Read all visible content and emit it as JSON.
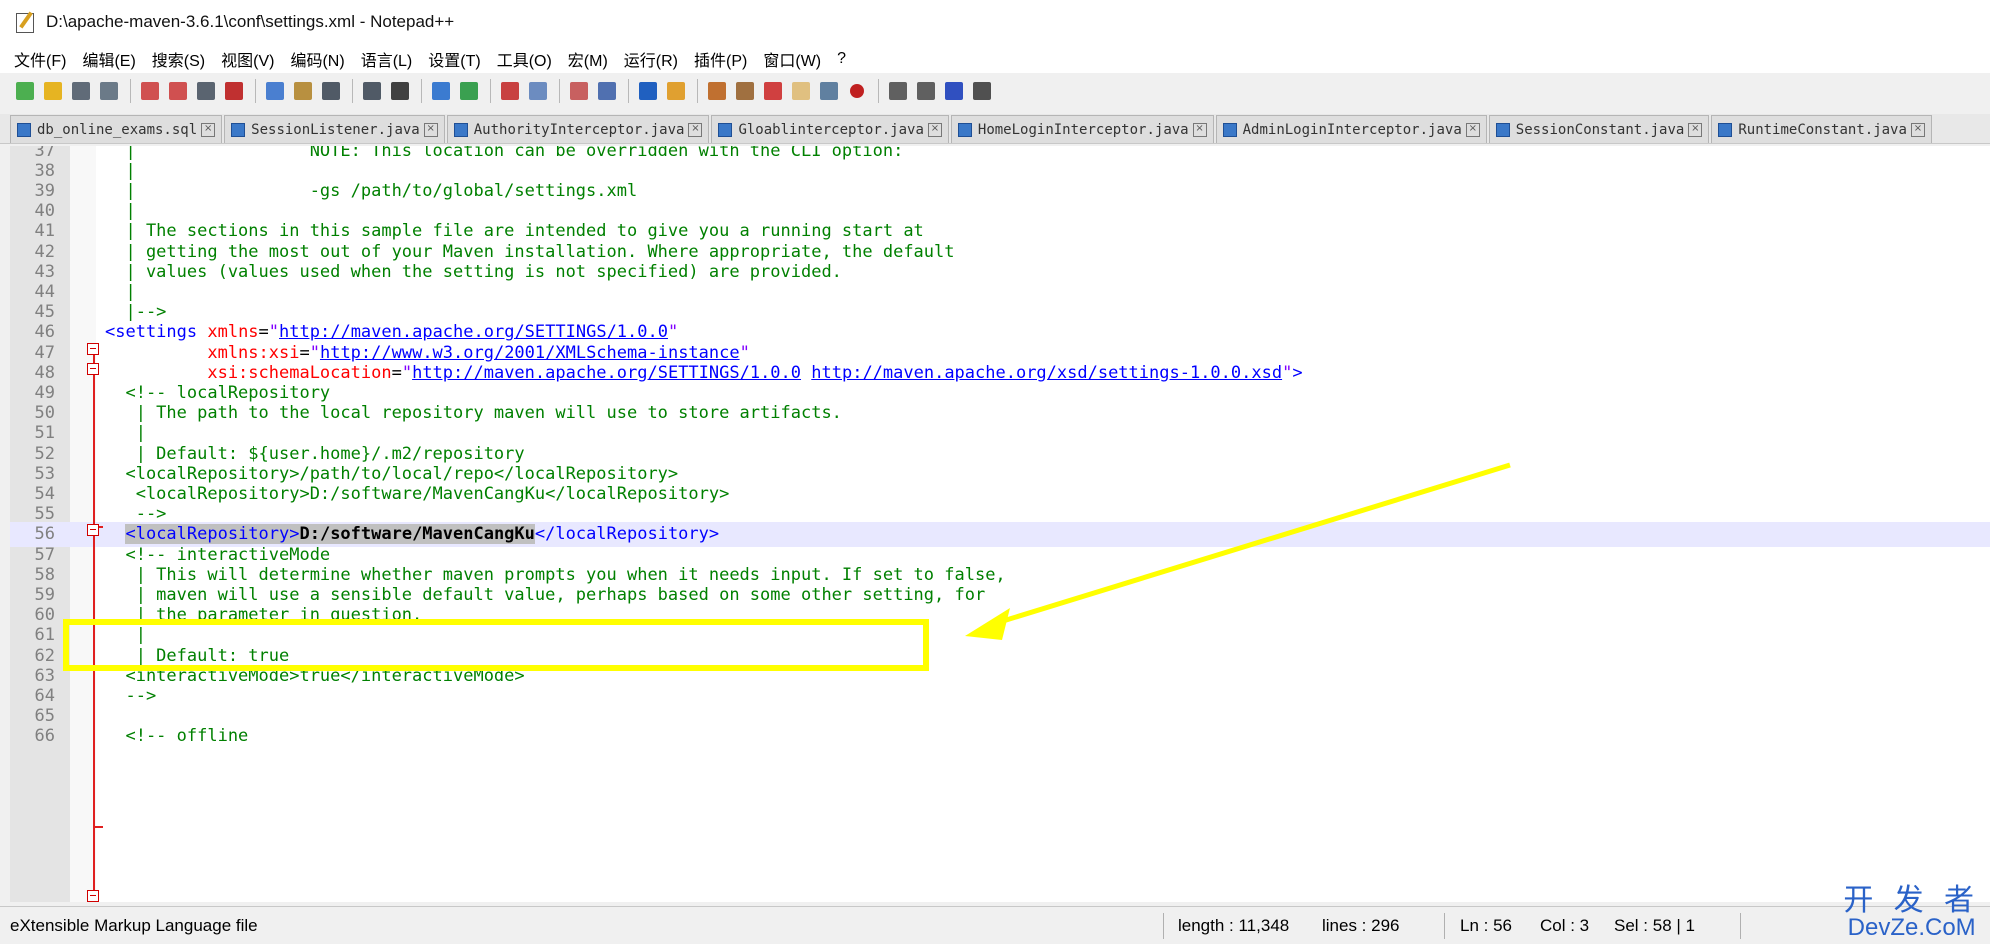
{
  "window": {
    "title": "D:\\apache-maven-3.6.1\\conf\\settings.xml - Notepad++"
  },
  "menu": [
    "文件(F)",
    "编辑(E)",
    "搜索(S)",
    "视图(V)",
    "编码(N)",
    "语言(L)",
    "设置(T)",
    "工具(O)",
    "宏(M)",
    "运行(R)",
    "插件(P)",
    "窗口(W)",
    "?"
  ],
  "tabs": [
    {
      "label": "db_online_exams.sql"
    },
    {
      "label": "SessionListener.java"
    },
    {
      "label": "AuthorityInterceptor.java"
    },
    {
      "label": "Gloablinterceptor.java"
    },
    {
      "label": "HomeLoginInterceptor.java"
    },
    {
      "label": "AdminLoginInterceptor.java"
    },
    {
      "label": "SessionConstant.java"
    },
    {
      "label": "RuntimeConstant.java"
    }
  ],
  "editor": {
    "lines": [
      {
        "n": "37",
        "segs": [
          {
            "t": "  |                 NOTE: This location can be overridden with the CLI option:",
            "c": "c"
          }
        ]
      },
      {
        "n": "38",
        "segs": [
          {
            "t": "  |",
            "c": "c"
          }
        ]
      },
      {
        "n": "39",
        "segs": [
          {
            "t": "  |                 -gs /path/to/global/settings.xml",
            "c": "c"
          }
        ]
      },
      {
        "n": "40",
        "segs": [
          {
            "t": "  |",
            "c": "c"
          }
        ]
      },
      {
        "n": "41",
        "segs": [
          {
            "t": "  | The sections in this sample file are intended to give you a running start at",
            "c": "c"
          }
        ]
      },
      {
        "n": "42",
        "segs": [
          {
            "t": "  | getting the most out of your Maven installation. Where appropriate, the default",
            "c": "c"
          }
        ]
      },
      {
        "n": "43",
        "segs": [
          {
            "t": "  | values (values used when the setting is not specified) are provided.",
            "c": "c"
          }
        ]
      },
      {
        "n": "44",
        "segs": [
          {
            "t": "  |",
            "c": "c"
          }
        ]
      },
      {
        "n": "45",
        "segs": [
          {
            "t": "  |-->",
            "c": "c"
          }
        ]
      },
      {
        "n": "46",
        "segs": [
          {
            "t": "<settings ",
            "c": "tag"
          },
          {
            "t": "xmlns",
            "c": "attr"
          },
          {
            "t": "=",
            "c": "eq"
          },
          {
            "t": "\"",
            "c": "val"
          },
          {
            "t": "http://maven.apache.org/SETTINGS/1.0.0",
            "c": "url"
          },
          {
            "t": "\"",
            "c": "val"
          }
        ]
      },
      {
        "n": "47",
        "segs": [
          {
            "t": "          xmlns:xsi",
            "c": "attr"
          },
          {
            "t": "=",
            "c": "eq"
          },
          {
            "t": "\"",
            "c": "val"
          },
          {
            "t": "http://www.w3.org/2001/XMLSchema-instance",
            "c": "url"
          },
          {
            "t": "\"",
            "c": "val"
          }
        ]
      },
      {
        "n": "48",
        "segs": [
          {
            "t": "          xsi:schemaLocation",
            "c": "attr"
          },
          {
            "t": "=",
            "c": "eq"
          },
          {
            "t": "\"",
            "c": "val"
          },
          {
            "t": "http://maven.apache.org/SETTINGS/1.0.0",
            "c": "url"
          },
          {
            "t": " ",
            "c": "val"
          },
          {
            "t": "http://maven.apache.org/xsd/settings-1.0.0.xsd",
            "c": "url"
          },
          {
            "t": "\"",
            "c": "val"
          },
          {
            "t": ">",
            "c": "tag"
          }
        ]
      },
      {
        "n": "49",
        "segs": [
          {
            "t": "  <!-- localRepository",
            "c": "c"
          }
        ]
      },
      {
        "n": "50",
        "segs": [
          {
            "t": "   | The path to the local repository maven will use to store artifacts.",
            "c": "c"
          }
        ]
      },
      {
        "n": "51",
        "segs": [
          {
            "t": "   |",
            "c": "c"
          }
        ]
      },
      {
        "n": "52",
        "segs": [
          {
            "t": "   | Default: ${user.home}/.m2/repository",
            "c": "c"
          }
        ]
      },
      {
        "n": "53",
        "segs": [
          {
            "t": "  <localRepository>/path/to/local/repo</localRepository>",
            "c": "c"
          }
        ]
      },
      {
        "n": "54",
        "segs": [
          {
            "t": "   <localRepository>D:/software/MavenCangKu</localRepository>",
            "c": "c"
          }
        ]
      },
      {
        "n": "55",
        "segs": [
          {
            "t": "   -->",
            "c": "c"
          }
        ]
      },
      {
        "n": "56",
        "cur": true,
        "segs": [
          {
            "t": "  ",
            "c": "black"
          },
          {
            "t": "<localRepository>",
            "c": "tagsel"
          },
          {
            "t": "D:/software/MavenCangKu",
            "c": "boldsel"
          },
          {
            "t": "</localRepository>",
            "c": "tag"
          }
        ]
      },
      {
        "n": "57",
        "segs": [
          {
            "t": "  <!-- interactiveMode",
            "c": "c"
          }
        ]
      },
      {
        "n": "58",
        "segs": [
          {
            "t": "   | This will determine whether maven prompts you when it needs input. If set to false,",
            "c": "c"
          }
        ]
      },
      {
        "n": "59",
        "segs": [
          {
            "t": "   | maven will use a sensible default value, perhaps based on some other setting, for",
            "c": "c"
          }
        ]
      },
      {
        "n": "60",
        "segs": [
          {
            "t": "   | the parameter in question.",
            "c": "c"
          }
        ]
      },
      {
        "n": "61",
        "segs": [
          {
            "t": "   |",
            "c": "c"
          }
        ]
      },
      {
        "n": "62",
        "segs": [
          {
            "t": "   | Default: true",
            "c": "c"
          }
        ]
      },
      {
        "n": "63",
        "segs": [
          {
            "t": "  <interactiveMode>true</interactiveMode>",
            "c": "c"
          }
        ]
      },
      {
        "n": "64",
        "segs": [
          {
            "t": "  -->",
            "c": "c"
          }
        ]
      },
      {
        "n": "65",
        "segs": [
          {
            "t": "",
            "c": "c"
          }
        ]
      },
      {
        "n": "66",
        "segs": [
          {
            "t": "  <!-- offline",
            "c": "c"
          }
        ]
      }
    ]
  },
  "status": {
    "filetype": "eXtensible Markup Language file",
    "length": "length : 11,348",
    "lines": "lines : 296",
    "ln": "Ln : 56",
    "col": "Col : 3",
    "sel": "Sel : 58 | 1"
  },
  "watermark": {
    "cn": "开 发 者",
    "en": "DevZe.CoM"
  },
  "colors": {
    "highlight": "#ffff00",
    "comment": "#008000",
    "tag": "#0000ff",
    "attr": "#ff0000",
    "value": "#8000ff",
    "fold": "#e02020"
  },
  "toolbar_icons": [
    "new-file-icon",
    "open-file-icon",
    "save-icon",
    "save-all-icon",
    "close-icon",
    "close-all-icon",
    "print-icon",
    "cut-icon",
    "copy-icon",
    "paste-icon",
    "undo-icon",
    "redo-icon",
    "find-icon",
    "replace-icon",
    "zoom-in-icon",
    "zoom-out-icon",
    "sync-v-icon",
    "sync-h-icon",
    "wrap-icon",
    "all-chars-icon",
    "indent-guide-icon",
    "udl-icon",
    "doc-map-icon",
    "function-list-icon",
    "folder-icon",
    "monitor-icon",
    "record-macro-icon",
    "stop-macro-icon",
    "play-macro-icon",
    "play-multi-icon",
    "save-macro-icon"
  ]
}
